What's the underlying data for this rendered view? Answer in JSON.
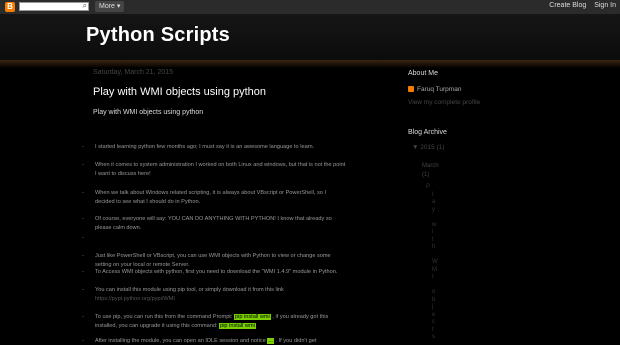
{
  "navbar": {
    "logo_glyph": "B",
    "more_label": "More ▾",
    "create_blog": "Create Blog",
    "sign_in": "Sign In"
  },
  "header": {
    "title": "Python Scripts"
  },
  "post": {
    "date": "Saturday, March 21, 2015",
    "title": "Play with WMI objects using python",
    "subtitle": "Play with WMI objects using python",
    "lines": [
      "I started learning python few months ago; I must say it is an awesome language to learn.",
      "When it comes to system administration I worked on both Linux and windows, but that is not the point",
      "I want to discuss here!",
      "When we talk about Windows related scripting, it is always about VBscript or PowerShell, so I",
      "decided to see what I should do in Python.",
      "Of course, everyone will say: YOU CAN DO ANYTHING WITH PYTHON! I know that already so",
      "please calm down.",
      "Just like PowerShell or VBscript, you can use WMI objects with Python to view or change some",
      "setting on your local or remote Server.",
      "To Access WMI objects with python, first you need to download the \"WMI 1.4.9\" module in Python.",
      "You can install this module using pip tool, or simply download it from this link",
      "https://pypi.python.org/pypi/WMI",
      "To use pip, you can run this from the command Prompt:",
      "pip install wmi",
      ", if you already got this",
      "installed, you can upgrade it using this command:",
      "pip install wmi",
      "After installing the module, you can open an IDLE session and notice",
      "...",
      ". If you didn't get"
    ]
  },
  "sidebar": {
    "about_heading": "About Me",
    "profile_name": "Faruq Turpman",
    "view_profile": "View my complete profile",
    "archive_heading": "Blog Archive",
    "archive_year": "▼  2015 (1)",
    "archive_month": "March",
    "archive_count": "(1)",
    "archive_letters": [
      "P",
      "l",
      "a",
      "y",
      "",
      "w",
      "i",
      "t",
      "h",
      "",
      "W",
      "M",
      "I",
      "",
      "o",
      "b",
      "j",
      "e",
      "c",
      "t",
      "s"
    ]
  },
  "colors": {
    "accent": "#f57d00",
    "highlight": "#7bd000",
    "background": "#000000"
  }
}
